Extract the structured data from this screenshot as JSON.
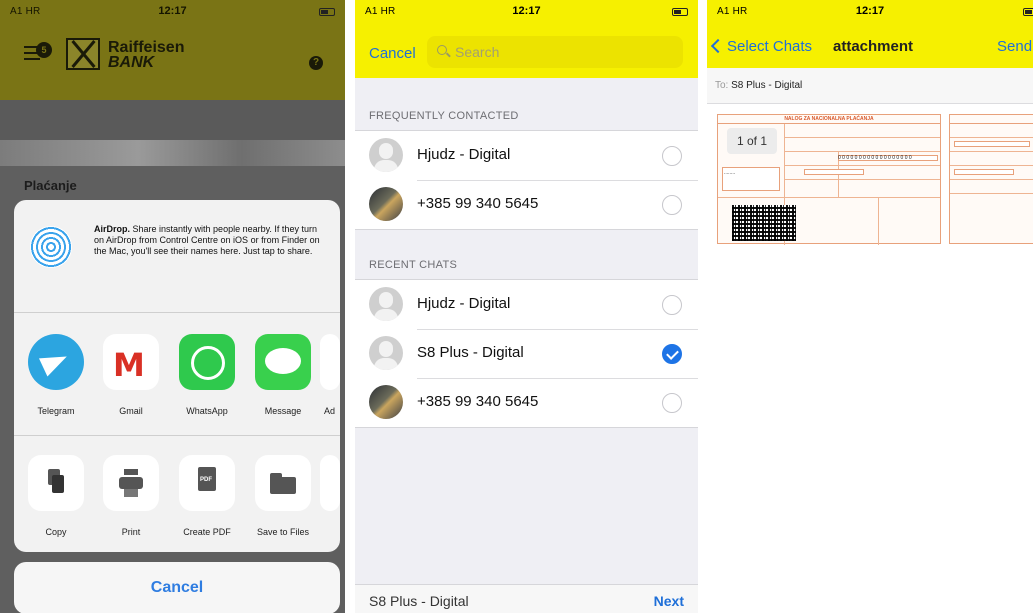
{
  "status": {
    "carrier": "A1 HR",
    "time": "12:17"
  },
  "panel1": {
    "bank_name_line1": "Raiffeisen",
    "bank_name_line2": "BANK",
    "menu_badge": "5",
    "help_glyph": "?",
    "page_heading": "Plaćanje",
    "airdrop": {
      "title": "AirDrop.",
      "text": "Share instantly with people nearby. If they turn on AirDrop from Control Centre on iOS or from Finder on the Mac, you'll see their names here. Just tap to share."
    },
    "apps": [
      {
        "label": "Telegram",
        "icon": "telegram-icon"
      },
      {
        "label": "Gmail",
        "icon": "gmail-icon"
      },
      {
        "label": "WhatsApp",
        "icon": "whatsapp-icon"
      },
      {
        "label": "Message",
        "icon": "message-icon"
      },
      {
        "label": "Ad",
        "icon": "more-app-icon"
      }
    ],
    "actions": [
      {
        "label": "Copy",
        "icon": "copy-icon"
      },
      {
        "label": "Print",
        "icon": "print-icon"
      },
      {
        "label": "Create PDF",
        "icon": "pdf-icon"
      },
      {
        "label": "Save to Files",
        "icon": "folder-icon"
      }
    ],
    "cancel_label": "Cancel"
  },
  "panel2": {
    "cancel_label": "Cancel",
    "search_placeholder": "Search",
    "frequent_header": "FREQUENTLY CONTACTED",
    "frequent": [
      {
        "name": "Hjudz - Digital",
        "selected": false
      },
      {
        "name": "+385 99 340 5645",
        "selected": false
      }
    ],
    "recent_header": "RECENT CHATS",
    "recent": [
      {
        "name": "Hjudz - Digital",
        "selected": false
      },
      {
        "name": "S8 Plus - Digital",
        "selected": true
      },
      {
        "name": "+385 99 340 5645",
        "selected": false
      }
    ],
    "bottom_selected": "S8 Plus - Digital",
    "next_label": "Next"
  },
  "panel3": {
    "back_label": "Select Chats",
    "title": "attachment",
    "send_label": "Send",
    "to_prefix": "To:",
    "to_name": "S8 Plus - Digital",
    "page_indicator": "1 of 1",
    "doc_header": "NALOG ZA NACIONALNA PLAĆANJA"
  },
  "colors": {
    "accent_yellow": "#f6f000",
    "ios_blue": "#1e6fd8",
    "bank_header": "#7a7415"
  }
}
